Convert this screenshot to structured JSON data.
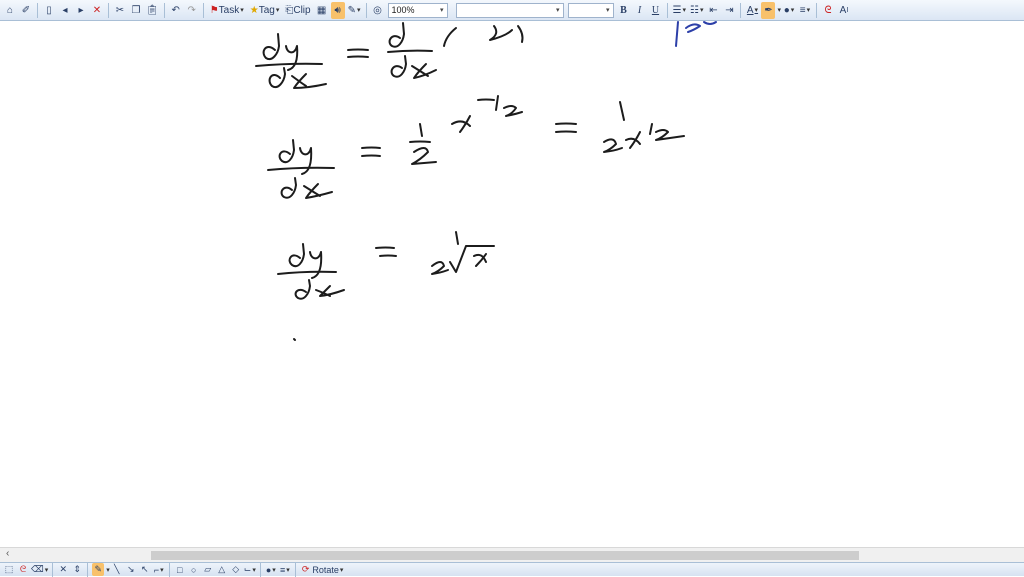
{
  "toolbar": {
    "task_label": "Task",
    "tag_label": "Tag",
    "clip_label": "Clip",
    "zoom_value": "100%",
    "font_name_value": "",
    "font_size_value": "",
    "bold_label": "B",
    "italic_label": "I",
    "underline_label": "U",
    "text_size_label": "A",
    "accent_color": "#f8c16b",
    "pen_color": "#1c1c1c"
  },
  "bottombar": {
    "rotate_label": "Rotate"
  },
  "icons": [
    "home-icon",
    "draw-icon",
    "new-page-icon",
    "prev-page-icon",
    "next-page-icon",
    "delete-page-icon",
    "cut-icon",
    "copy-icon",
    "paste-icon",
    "undo-icon",
    "redo-icon",
    "task-flag-icon",
    "tag-star-icon",
    "clip-icon",
    "table-icon",
    "audio-icon",
    "pen-tool-icon",
    "zoom-icon",
    "bullets-icon",
    "numbering-icon",
    "outdent-icon",
    "indent-icon",
    "font-color-icon",
    "highlighter-icon",
    "fill-color-icon",
    "line-style-icon",
    "lasso-icon",
    "text-size-icon"
  ]
}
